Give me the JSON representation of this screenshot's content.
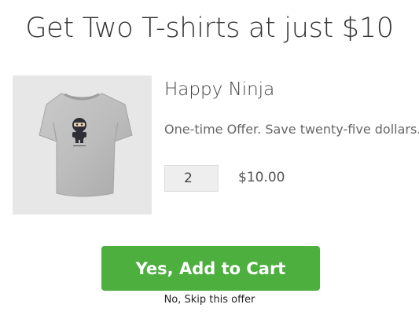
{
  "headline": "Get Two T-shirts at just $10",
  "product": {
    "image_icon": "tshirt-ninja-image",
    "title": "Happy Ninja",
    "description": "One-time Offer. Save twenty-five dollars.",
    "quantity": "2",
    "price": "$10.00"
  },
  "actions": {
    "accept_label": "Yes, Add to Cart",
    "decline_label": "No, Skip this offer"
  },
  "colors": {
    "accept_button": "#4caf3e",
    "image_background": "#e7e7e7"
  }
}
